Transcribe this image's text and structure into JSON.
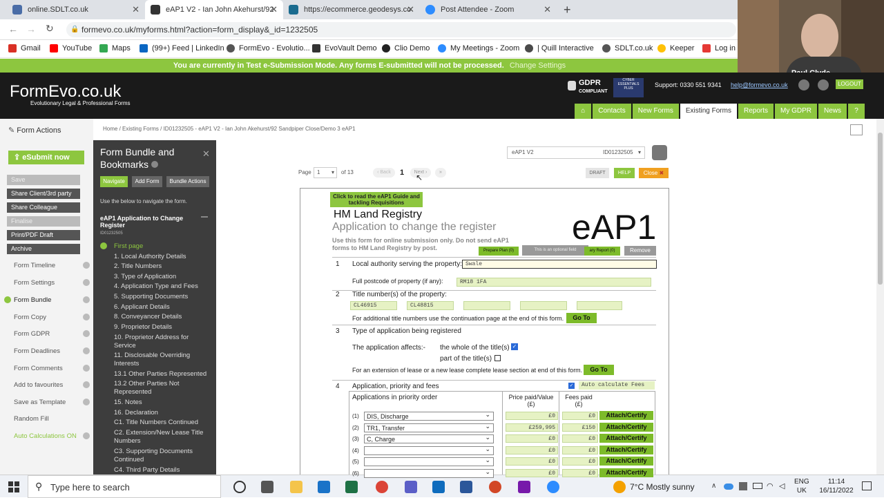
{
  "browser": {
    "tabs": [
      {
        "title": "online.SDLT.co.uk",
        "color": "#4a6da7"
      },
      {
        "title": "eAP1 V2 - Ian John Akehurst/92",
        "color": "#333333"
      },
      {
        "title": "https://ecommerce.geodesys.co",
        "color": "#1a6b8f"
      },
      {
        "title": "Post Attendee - Zoom",
        "color": "#2d8cff"
      }
    ],
    "url": "formevo.co.uk/myforms.html?action=form_display&_id=1232505",
    "bookmarks": [
      "Gmail",
      "YouTube",
      "Maps",
      "(99+) Feed | LinkedIn",
      "FormEvo - Evolutio...",
      "EvoVault Demo",
      "Clio Demo",
      "My Meetings - Zoom",
      "| Quill Interactive",
      "SDLT.co.uk",
      "Keeper",
      "Log in"
    ]
  },
  "banner": {
    "text": "You are currently in Test e-Submission Mode. Any forms E-submitted will not be processed.",
    "link": "Change Settings"
  },
  "header": {
    "logo": "FormEvo.co.uk",
    "tagline": "Evolutionary Legal & Professional Forms",
    "gdpr1": "GDPR",
    "gdpr2": "COMPLIANT",
    "support": "Support: 0330 551 9341",
    "email": "help@formevo.co.uk",
    "logout": "LOGOUT",
    "participant": "Paul Clyde",
    "nav": [
      "Contacts",
      "New Forms",
      "Existing Forms",
      "Reports",
      "My GDPR",
      "News"
    ]
  },
  "breadcrumb": "Home / Existing Forms / ID01232505 - eAP1 V2 - Ian John Akehurst/92 Sandpiper Close/Demo 3 eAP1",
  "sidebar": {
    "title": "Form Actions",
    "esubmit": "eSubmit now",
    "buttons": [
      "Save",
      "Share Client/3rd party",
      "Share Colleague",
      "Finalise",
      "Print/PDF Draft",
      "Archive"
    ],
    "items": [
      "Form Timeline",
      "Form Settings",
      "Form Bundle",
      "Form Copy",
      "Form GDPR",
      "Form Deadlines",
      "Form Comments",
      "Add to favourites",
      "Save as Template",
      "Random Fill",
      "Auto Calculations ON"
    ]
  },
  "bundle": {
    "title": "Form Bundle and Bookmarks",
    "tabs": [
      "Navigate",
      "Add Form",
      "Bundle Actions"
    ],
    "hint": "Use the below to navigate the form.",
    "doc": "eAP1 Application to Change Register",
    "docid": "ID01232505",
    "items": [
      "First page",
      "1. Local Authority Details",
      "2. Title Numbers",
      "3. Type of Application",
      "4. Application Type and Fees",
      "5. Supporting Documents",
      "6. Applicant Details",
      "8. Conveyancer Details",
      "9. Proprietor Details",
      "10. Proprietor Address for Service",
      "11. Disclosable Overriding Interests",
      "13.1 Other Parties Represented",
      "13.2 Other Parties Not Represented",
      "15. Notes",
      "16. Declaration",
      "C1. Title Numbers Continued",
      "C2. Extension/New Lease Title Numbers",
      "C3. Supporting Documents Continued",
      "C4. Third Party Details"
    ]
  },
  "toolbar": {
    "form_select": "eAP1 V2",
    "form_id": "ID01232505",
    "page_label": "Page",
    "page_value": "1",
    "of": "of 13",
    "back": "Back",
    "current": "1",
    "next": "Next",
    "draft": "DRAFT",
    "help": "HELP",
    "close": "Close"
  },
  "form": {
    "guide": "Click to read the eAP1 Guide and tackling Requisitions",
    "title1": "HM Land Registry",
    "title2": "Application to change the register",
    "big": "eAP1",
    "intro": "Use this form for online submission only. Do not send eAP1 forms to HM Land Registry by post.",
    "prepare_plan": "Prepare Plan (0)",
    "tooltip": "This is an optional field",
    "report": "ary Report (0)",
    "remove": "Remove",
    "s1_num": "1",
    "s1_label": "Local authority serving the property:",
    "s1_value": "Swale",
    "postcode_label": "Full postcode of property (if any):",
    "postcode_value": "RM18 1FA",
    "s2_num": "2",
    "s2_label": "Title number(s) of the property:",
    "titles": [
      "CL46915",
      "CL48815",
      "",
      "",
      ""
    ],
    "s2_note": "For additional title numbers use the continuation page at the end of this form.",
    "goto": "Go To",
    "s3_num": "3",
    "s3_label": "Type of application being registered",
    "affects": "The application affects:-",
    "whole": "the whole of the title(s)",
    "part": "part of the title(s)",
    "s3_note": "For an extension of lease or a new lease complete lease section at end of this form.",
    "s4_num": "4",
    "s4_label": "Application, priority and fees",
    "auto_calc": "Auto calculate Fees",
    "col_app": "Applications in priority order",
    "col_price": "Price paid/Value (£)",
    "col_fees": "Fees paid (£)",
    "apps": [
      {
        "n": "(1)",
        "v": "DIS, Discharge",
        "price": "£0",
        "fee": "£0"
      },
      {
        "n": "(2)",
        "v": "TR1, Transfer",
        "price": "£259,995",
        "fee": "£150"
      },
      {
        "n": "(3)",
        "v": "C, Charge",
        "price": "£0",
        "fee": "£0"
      },
      {
        "n": "(4)",
        "v": "",
        "price": "£0",
        "fee": "£0"
      },
      {
        "n": "(5)",
        "v": "",
        "price": "£0",
        "fee": "£0"
      },
      {
        "n": "(6)",
        "v": "",
        "price": "£0",
        "fee": "£0"
      }
    ],
    "attach": "Attach/Certify"
  },
  "taskbar": {
    "search": "Type here to search",
    "weather": "7°C  Mostly sunny",
    "lang1": "ENG",
    "lang2": "UK",
    "time": "11:14",
    "date": "16/11/2022"
  }
}
